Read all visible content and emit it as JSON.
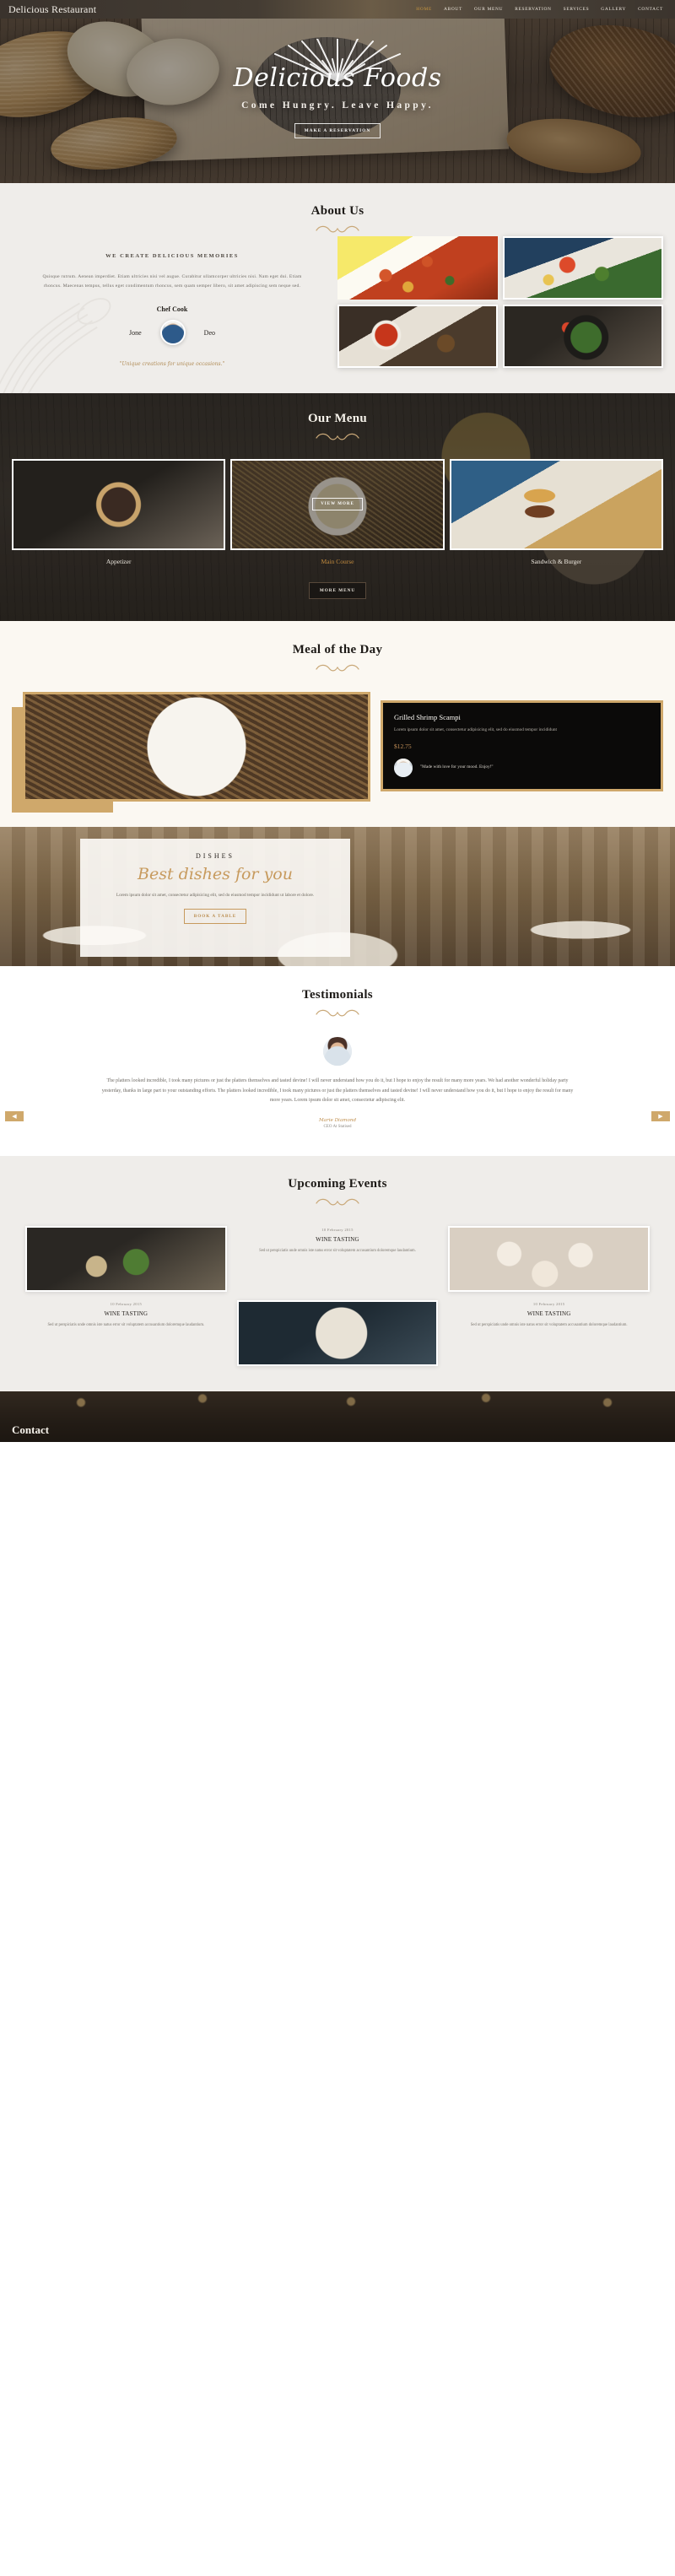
{
  "header": {
    "brand": "Delicious Restaurant",
    "nav": [
      {
        "label": "HOME",
        "active": true
      },
      {
        "label": "ABOUT",
        "active": false
      },
      {
        "label": "OUR MENU",
        "active": false
      },
      {
        "label": "RESERVATION",
        "active": false
      },
      {
        "label": "SERVICES",
        "active": false
      },
      {
        "label": "GALLERY",
        "active": false
      },
      {
        "label": "CONTACT",
        "active": false
      }
    ],
    "accent_color": "#c9973f"
  },
  "hero": {
    "title": "Delicious Foods",
    "subtitle": "Come Hungry. Leave Happy.",
    "button": "MAKE A RESERVATION"
  },
  "about": {
    "title": "About Us",
    "eyebrow": "WE CREATE DELICIOUS MEMORIES",
    "paragraph": "Quisque rutrum. Aenean imperdiet. Etiam ultricies nisi vel augue. Curabitur ullamcorper ultricies nisi. Nam eget dui. Etiam rhoncus. Maecenas tempus, tellus eget condimentum rhoncus, sem quam semper libero, sit amet adipiscing sem neque sed.",
    "chef_label": "Chef Cook",
    "chef_left": "Jone",
    "chef_right": "Deo",
    "quote": "\"Unique creations for unique occasions.\"",
    "photos": [
      "pizza-platter",
      "salad-bowl",
      "dip-platter",
      "green-bowl"
    ]
  },
  "menu": {
    "title": "Our Menu",
    "view_more": "VIEW MORE",
    "more_button": "MORE MENU",
    "cards": [
      {
        "label": "Appetizer",
        "image": "tart-with-berries",
        "active": false
      },
      {
        "label": "Main Course",
        "image": "creamy-pasta",
        "active": true
      },
      {
        "label": "Sandwich & Burger",
        "image": "burger-and-fries",
        "active": false
      }
    ]
  },
  "meal": {
    "title": "Meal of the Day",
    "photo": "noodle-plate-on-wood",
    "name": "Grilled Shrimp Scampi",
    "description": "Lorem ipsum dolor sit amet, consectetur adipisicing elit, sed do eiusmod tempor incididunt",
    "price": "$12.75",
    "quote": "\"Made with love for your mood. Enjoy!\"",
    "accent_color": "#cfa86b"
  },
  "dishes": {
    "eyebrow": "DISHES",
    "title": "Best dishes for you",
    "text": "Lorem ipsum dolor sit amet, consectetur adipisicing elit, sed do eiusmod tempor incididunt ut labore et dolore.",
    "button": "BOOK A TABLE"
  },
  "testimonials": {
    "title": "Testimonials",
    "avatar": "woman-portrait",
    "text": "The platters looked incredible, I took many pictures or just the platters themselves and tasted devine! I will never understand how you do it, but I hope to enjoy the result for many more years. We had another wonderful holiday party yesterday, thanks in large part to your outstanding efforts. The platters looked incredible, I took many pictures or just the platters themselves and tasted devine! I will never understand how you do it, but I hope to enjoy the result for many more years. Lorem ipsum dolor sit amet, consectetur adipiscing elit.",
    "name": "Marie Diamond",
    "role": "CEO At Statised",
    "prev_icon": "◀",
    "next_icon": "▶"
  },
  "events": {
    "title": "Upcoming Events",
    "items": [
      {
        "image": "avocado-toast-plate",
        "date": "",
        "title": "",
        "description": ""
      },
      {
        "image": "",
        "date": "10 February 2015",
        "title": "WINE TASTING",
        "description": "Sed ut perspiciatis unde omnis iste natus error sit voluptatem accusantium doloremque laudantium."
      },
      {
        "image": "cupcakes-tray",
        "date": "",
        "title": "",
        "description": ""
      },
      {
        "image": "",
        "date": "10 February 2015",
        "title": "WINE TASTING",
        "description": "Sed ut perspiciatis unde omnis iste natus error sit voluptatem accusantium doloremque laudantium."
      },
      {
        "image": "dessert-plate-dark",
        "date": "",
        "title": "",
        "description": ""
      },
      {
        "image": "",
        "date": "10 February 2015",
        "title": "WINE TASTING",
        "description": "Sed ut perspiciatis unde omnis iste natus error sit voluptatem accusantium doloremque laudantium."
      }
    ]
  },
  "contact": {
    "title": "Contact"
  }
}
